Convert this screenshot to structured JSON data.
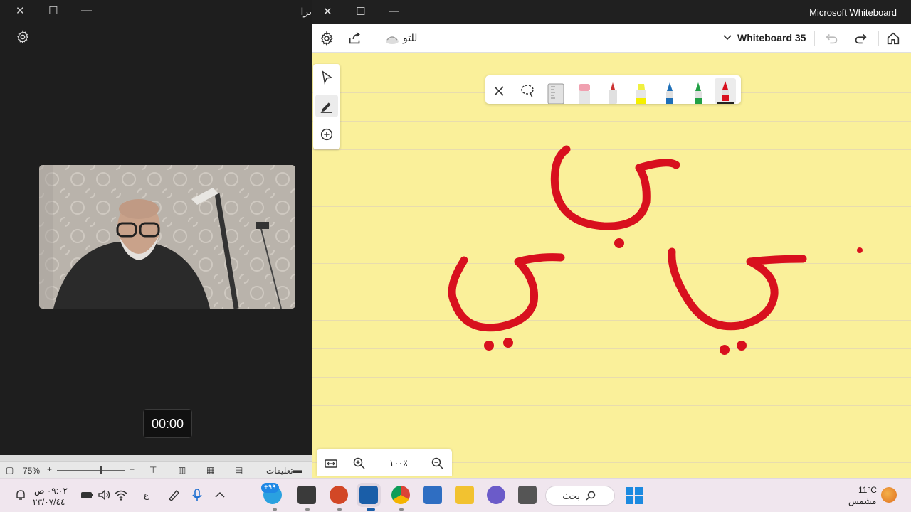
{
  "camera_window": {
    "title": "يرا",
    "controls": {
      "close": "✕",
      "maximize": "☐",
      "minimize": "—"
    },
    "timer": "00:00"
  },
  "status_bar": {
    "zoom_level": "75%",
    "comments_label": "تعليقات",
    "zoom_minus": "−",
    "zoom_plus": "+"
  },
  "whiteboard": {
    "app_name": "Microsoft Whiteboard",
    "controls": {
      "close": "✕",
      "maximize": "☐",
      "minimize": "—"
    },
    "logo_text": "للتو",
    "board_name": "Whiteboard 35",
    "zoom_percent": "١٠٠٪",
    "ink_color": "#d8101e",
    "ink_tools": [
      "close",
      "lasso",
      "ruler",
      "eraser",
      "pen-gray",
      "highlighter-yellow",
      "pen-blue",
      "pen-green",
      "pen-red"
    ],
    "canvas_letters": [
      "ب",
      "ي",
      "ي"
    ]
  },
  "taskbar": {
    "time": "٠٩:٠٢ ص",
    "date": "٢٣/٠٧/٤٤",
    "language": "ع",
    "search_label": "بحث",
    "weather_temp": "11°C",
    "weather_desc": "مشمس",
    "notification_badge": "+٩٩"
  }
}
